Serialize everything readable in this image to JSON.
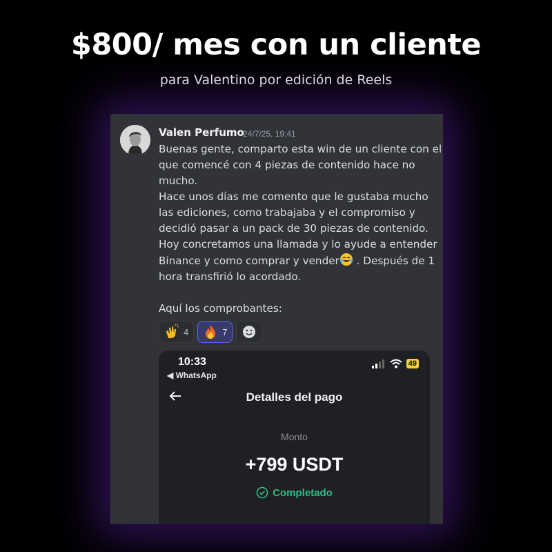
{
  "header": {
    "headline": "$800/ mes con un cliente",
    "subline": "para Valentino por edición de Reels"
  },
  "post": {
    "username": "Valen Perfumo",
    "timestamp": "24/7/25, 19:41",
    "lines": {
      "l1": "Buenas gente, comparto esta win de un cliente con el",
      "l2": "que comencé con 4 piezas de contenido hace no",
      "l3": "mucho.",
      "l4": "Hace unos días me comento que le gustaba mucho",
      "l5": "las ediciones, como trabajaba y el compromiso y",
      "l6": "decidió pasar a un pack de 30 piezas de contenido.",
      "l7": "Hoy concretamos una llamada y lo ayude a entender",
      "l8a": "Binance y como comprar y vender",
      "l8b": " . Después de 1",
      "l9": "hora transfirió lo acordado.",
      "l10": "Aquí los comprobantes:"
    },
    "inline_emoji": "joy-emoji",
    "reactions": [
      {
        "icon": "clap-emoji",
        "count": "4",
        "active": false
      },
      {
        "icon": "fire-emoji",
        "count": "7",
        "active": true
      },
      {
        "icon": "add-reaction-icon",
        "count": "",
        "active": false
      }
    ]
  },
  "phone": {
    "time": "10:33",
    "back_app": "◀ WhatsApp",
    "battery": "49",
    "title": "Detalles del pago",
    "amount_label": "Monto",
    "amount": "+799 USDT",
    "status": "Completado",
    "colors": {
      "success": "#2ebd85",
      "battery": "#f4d03f"
    }
  },
  "colors": {
    "card_bg": "#313338",
    "glow": "#6e28c8",
    "reaction_active": "#5865f2"
  }
}
